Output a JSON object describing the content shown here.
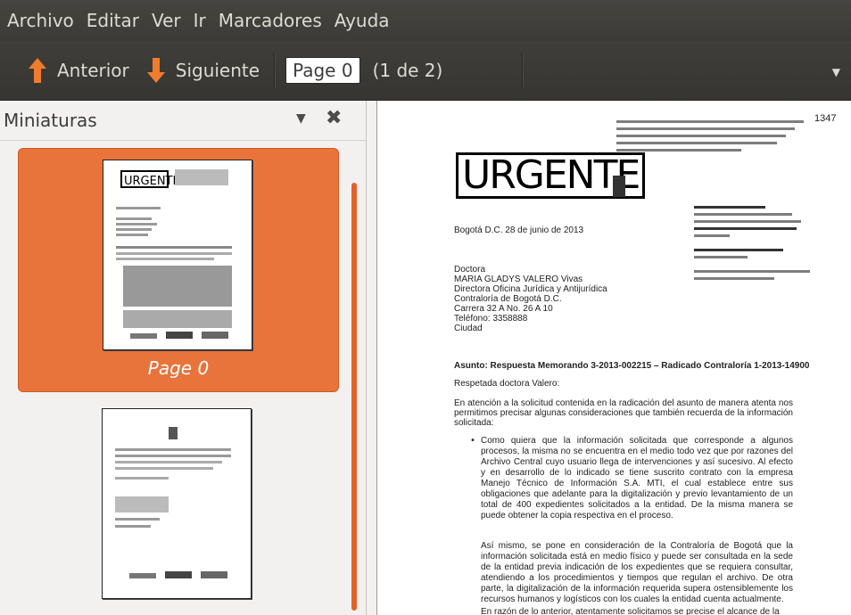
{
  "menubar": {
    "items": [
      "Archivo",
      "Editar",
      "Ver",
      "Ir",
      "Marcadores",
      "Ayuda"
    ]
  },
  "toolbar": {
    "previous_label": "Anterior",
    "next_label": "Siguiente",
    "page_value": "Page 0",
    "page_count": "(1 de 2)"
  },
  "sidebar": {
    "title": "Miniaturas",
    "thumbnails": [
      {
        "label": "Page 0",
        "selected": true
      }
    ]
  },
  "document": {
    "stamp_text": "URGENTE",
    "corner_number": "1347",
    "city_date": "Bogotá D.C. 28 de junio de 2013",
    "address": [
      "Doctora",
      "MARIA GLADYS VALERO Vivas",
      "Directora Oficina Jurídica y Antijurídica",
      "Contraloría de Bogotá D.C.",
      "Carrera 32 A No. 26 A 10",
      "Teléfono: 3358888",
      "Ciudad"
    ],
    "asunto": "Asunto: Respuesta Memorando 3-2013-002215 – Radicado Contraloría 1-2013-14900",
    "greeting": "Respetada doctora Valero:",
    "paragraph1": "En atención a la solicitud contenida en la radicación del asunto de manera atenta nos permitimos precisar algunas consideraciones que también recuerda de la información solicitada:",
    "bullet1": "Como quiera que la información solicitada que corresponde a algunos procesos, la misma no se encuentra en el medio todo vez que por razones del Archivo Central cuyo usuario llega de intervenciones y así sucesivo. Al efecto y en desarrollo de lo indicado se tiene suscrito contrato con la empresa Manejo Técnico de Información S.A. MTI, el cual establece entre sus obligaciones que adelante para la digitalización y previo levantamiento de un total de 400 expedientes solicitados a la entidad. De la misma manera se puede obtener la copia respectiva en el proceso.",
    "paragraph2": "Así mismo, se pone en consideración de la Contraloría de Bogotá que la información solicitada está en medio físico y puede ser consultada en la sede de la entidad previa indicación de los expedientes que se requiera consultar, atendiendo a los procedimientos y tiempos que regulan el archivo. De otra parte, la digitalización de la información requerida supera ostensiblemente los recursos humanos y logísticos con los cuales la entidad cuenta actualmente.",
    "paragraph3": "En razón de lo anterior, atentamente solicitamos se precise el alcance de la solicitud."
  },
  "colors": {
    "menubar_bg": "#3c3b37",
    "accent": "#e8743c",
    "arrow": "#f07c2d",
    "sidebar_bg": "#f2f1f0"
  }
}
